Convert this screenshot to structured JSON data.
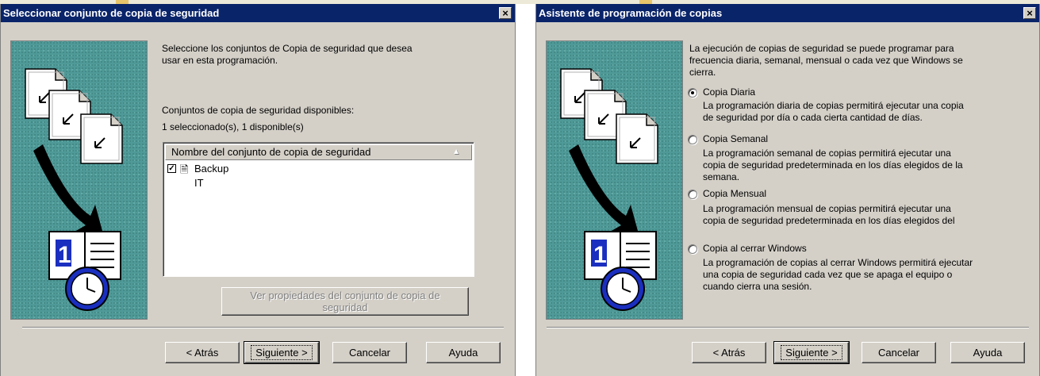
{
  "dialog1": {
    "title": "Seleccionar conjunto de copia de seguridad",
    "close_label": "×",
    "intro": [
      "Seleccione los conjuntos de Copia de seguridad que desea",
      "usar en esta programación."
    ],
    "available_label": "Conjuntos de copia de seguridad disponibles:",
    "count_label": "1 seleccionado(s), 1 disponible(s)",
    "list_header": "Nombre del conjunto de copia de seguridad",
    "items": [
      {
        "label": "Backup IT",
        "checked": true
      }
    ],
    "properties_button": [
      "Ver propiedades del conjunto de copia de",
      "seguridad"
    ],
    "buttons": {
      "back": "< Atrás",
      "next": "Siguiente >",
      "cancel": "Cancelar",
      "help": "Ayuda"
    }
  },
  "dialog2": {
    "title": "Asistente de programación de copias",
    "close_label": "×",
    "intro": [
      "La ejecución de copias de seguridad se puede programar para",
      "frecuencia diaria, semanal, mensual o cada vez que Windows se",
      "cierra."
    ],
    "options": [
      {
        "label": "Copia Diaria",
        "selected": true,
        "desc": [
          "La programación diaria de copias permitirá ejecutar una copia",
          "de seguridad por día o cada cierta cantidad de días."
        ]
      },
      {
        "label": "Copia Semanal",
        "selected": false,
        "desc": [
          "La programación semanal de copias permitirá ejecutar una",
          "copia de seguridad predeterminada en los días elegidos de la",
          "semana."
        ]
      },
      {
        "label": "Copia Mensual",
        "selected": false,
        "desc": [
          "La programación mensual de copias permitirá ejecutar una",
          "copia de seguridad predeterminada en los días elegidos del"
        ]
      },
      {
        "label": "Copia al cerrar Windows",
        "selected": false,
        "desc": [
          "La programación de copias al cerrar Windows permitirá ejecutar",
          "una copia de seguridad cada vez que se apaga el equipo o",
          "cuando cierra una sesión."
        ]
      }
    ],
    "buttons": {
      "back": "< Atrás",
      "next": "Siguiente >",
      "cancel": "Cancelar",
      "help": "Ayuda"
    }
  },
  "colors": {
    "titlebar": "#0a246a",
    "face": "#d4d0c8",
    "art_bg": "#4f9a98"
  }
}
